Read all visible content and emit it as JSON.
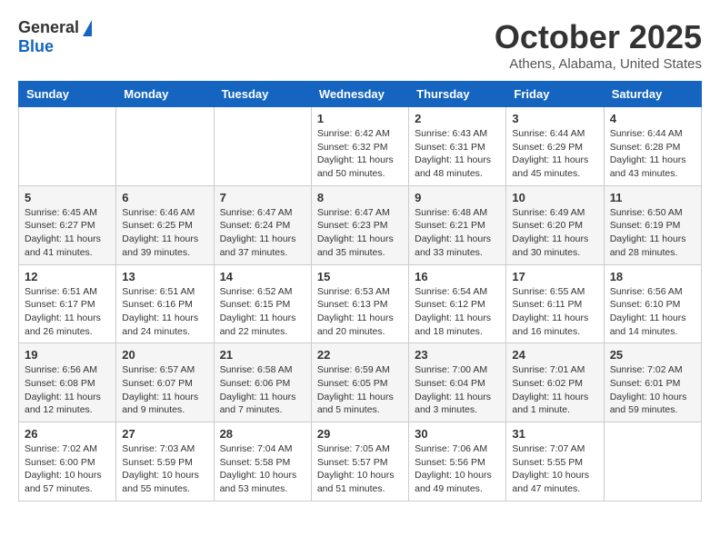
{
  "header": {
    "logo_general": "General",
    "logo_blue": "Blue",
    "title": "October 2025",
    "subtitle": "Athens, Alabama, United States"
  },
  "weekdays": [
    "Sunday",
    "Monday",
    "Tuesday",
    "Wednesday",
    "Thursday",
    "Friday",
    "Saturday"
  ],
  "weeks": [
    [
      {
        "day": "",
        "info": ""
      },
      {
        "day": "",
        "info": ""
      },
      {
        "day": "",
        "info": ""
      },
      {
        "day": "1",
        "info": "Sunrise: 6:42 AM\nSunset: 6:32 PM\nDaylight: 11 hours\nand 50 minutes."
      },
      {
        "day": "2",
        "info": "Sunrise: 6:43 AM\nSunset: 6:31 PM\nDaylight: 11 hours\nand 48 minutes."
      },
      {
        "day": "3",
        "info": "Sunrise: 6:44 AM\nSunset: 6:29 PM\nDaylight: 11 hours\nand 45 minutes."
      },
      {
        "day": "4",
        "info": "Sunrise: 6:44 AM\nSunset: 6:28 PM\nDaylight: 11 hours\nand 43 minutes."
      }
    ],
    [
      {
        "day": "5",
        "info": "Sunrise: 6:45 AM\nSunset: 6:27 PM\nDaylight: 11 hours\nand 41 minutes."
      },
      {
        "day": "6",
        "info": "Sunrise: 6:46 AM\nSunset: 6:25 PM\nDaylight: 11 hours\nand 39 minutes."
      },
      {
        "day": "7",
        "info": "Sunrise: 6:47 AM\nSunset: 6:24 PM\nDaylight: 11 hours\nand 37 minutes."
      },
      {
        "day": "8",
        "info": "Sunrise: 6:47 AM\nSunset: 6:23 PM\nDaylight: 11 hours\nand 35 minutes."
      },
      {
        "day": "9",
        "info": "Sunrise: 6:48 AM\nSunset: 6:21 PM\nDaylight: 11 hours\nand 33 minutes."
      },
      {
        "day": "10",
        "info": "Sunrise: 6:49 AM\nSunset: 6:20 PM\nDaylight: 11 hours\nand 30 minutes."
      },
      {
        "day": "11",
        "info": "Sunrise: 6:50 AM\nSunset: 6:19 PM\nDaylight: 11 hours\nand 28 minutes."
      }
    ],
    [
      {
        "day": "12",
        "info": "Sunrise: 6:51 AM\nSunset: 6:17 PM\nDaylight: 11 hours\nand 26 minutes."
      },
      {
        "day": "13",
        "info": "Sunrise: 6:51 AM\nSunset: 6:16 PM\nDaylight: 11 hours\nand 24 minutes."
      },
      {
        "day": "14",
        "info": "Sunrise: 6:52 AM\nSunset: 6:15 PM\nDaylight: 11 hours\nand 22 minutes."
      },
      {
        "day": "15",
        "info": "Sunrise: 6:53 AM\nSunset: 6:13 PM\nDaylight: 11 hours\nand 20 minutes."
      },
      {
        "day": "16",
        "info": "Sunrise: 6:54 AM\nSunset: 6:12 PM\nDaylight: 11 hours\nand 18 minutes."
      },
      {
        "day": "17",
        "info": "Sunrise: 6:55 AM\nSunset: 6:11 PM\nDaylight: 11 hours\nand 16 minutes."
      },
      {
        "day": "18",
        "info": "Sunrise: 6:56 AM\nSunset: 6:10 PM\nDaylight: 11 hours\nand 14 minutes."
      }
    ],
    [
      {
        "day": "19",
        "info": "Sunrise: 6:56 AM\nSunset: 6:08 PM\nDaylight: 11 hours\nand 12 minutes."
      },
      {
        "day": "20",
        "info": "Sunrise: 6:57 AM\nSunset: 6:07 PM\nDaylight: 11 hours\nand 9 minutes."
      },
      {
        "day": "21",
        "info": "Sunrise: 6:58 AM\nSunset: 6:06 PM\nDaylight: 11 hours\nand 7 minutes."
      },
      {
        "day": "22",
        "info": "Sunrise: 6:59 AM\nSunset: 6:05 PM\nDaylight: 11 hours\nand 5 minutes."
      },
      {
        "day": "23",
        "info": "Sunrise: 7:00 AM\nSunset: 6:04 PM\nDaylight: 11 hours\nand 3 minutes."
      },
      {
        "day": "24",
        "info": "Sunrise: 7:01 AM\nSunset: 6:02 PM\nDaylight: 11 hours\nand 1 minute."
      },
      {
        "day": "25",
        "info": "Sunrise: 7:02 AM\nSunset: 6:01 PM\nDaylight: 10 hours\nand 59 minutes."
      }
    ],
    [
      {
        "day": "26",
        "info": "Sunrise: 7:02 AM\nSunset: 6:00 PM\nDaylight: 10 hours\nand 57 minutes."
      },
      {
        "day": "27",
        "info": "Sunrise: 7:03 AM\nSunset: 5:59 PM\nDaylight: 10 hours\nand 55 minutes."
      },
      {
        "day": "28",
        "info": "Sunrise: 7:04 AM\nSunset: 5:58 PM\nDaylight: 10 hours\nand 53 minutes."
      },
      {
        "day": "29",
        "info": "Sunrise: 7:05 AM\nSunset: 5:57 PM\nDaylight: 10 hours\nand 51 minutes."
      },
      {
        "day": "30",
        "info": "Sunrise: 7:06 AM\nSunset: 5:56 PM\nDaylight: 10 hours\nand 49 minutes."
      },
      {
        "day": "31",
        "info": "Sunrise: 7:07 AM\nSunset: 5:55 PM\nDaylight: 10 hours\nand 47 minutes."
      },
      {
        "day": "",
        "info": ""
      }
    ]
  ]
}
